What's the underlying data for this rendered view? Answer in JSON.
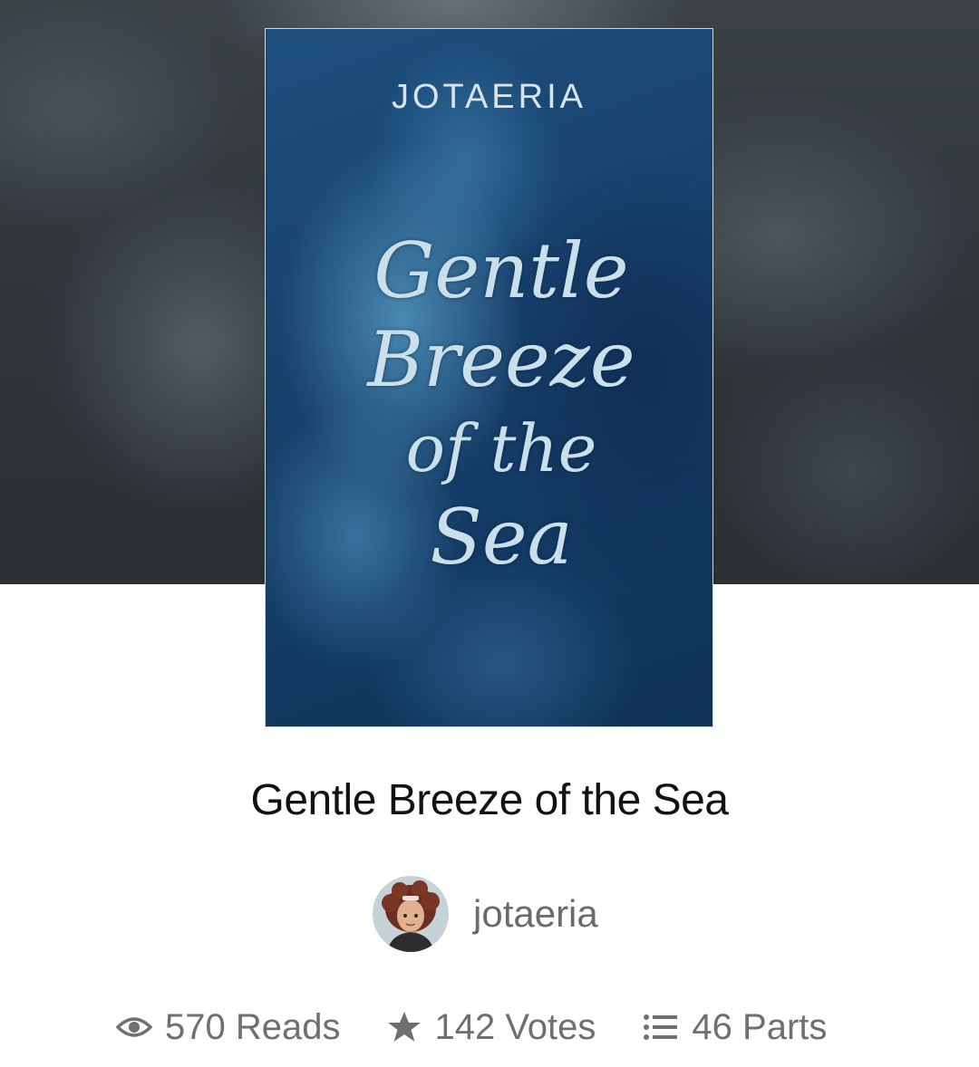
{
  "cover": {
    "author_text": "JOTAERIA",
    "title_lines": [
      "Gentle",
      "Breeze",
      "of the",
      "Sea"
    ]
  },
  "story": {
    "title": "Gentle Breeze of the Sea",
    "author": "jotaeria"
  },
  "stats": {
    "reads": "570 Reads",
    "votes": "142 Votes",
    "parts": "46 Parts"
  },
  "icons": {
    "reads": "eye-icon",
    "votes": "star-icon",
    "parts": "list-icon"
  },
  "colors": {
    "title_text": "#121212",
    "meta_text": "#6f6f6f",
    "cover_blue": "#17426d"
  }
}
